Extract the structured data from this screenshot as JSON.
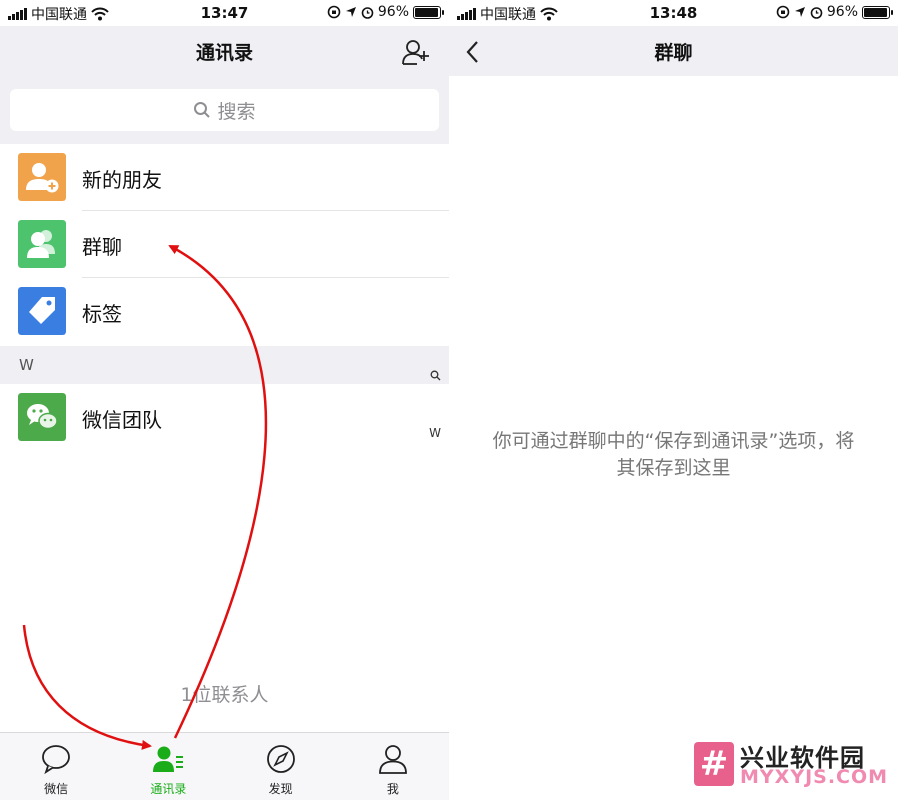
{
  "left_screen": {
    "status_bar": {
      "carrier": "中国联通",
      "time": "13:47",
      "battery": "96%"
    },
    "nav": {
      "title": "通讯录",
      "add_friend_icon": "add-contact-icon"
    },
    "search": {
      "placeholder": "搜索"
    },
    "top_items": [
      {
        "label": "新的朋友",
        "icon": "new-friend-icon",
        "color": "#f0a34a"
      },
      {
        "label": "群聊",
        "icon": "group-chat-icon",
        "color": "#4cc36c"
      },
      {
        "label": "标签",
        "icon": "tag-icon",
        "color": "#3a7ee2"
      }
    ],
    "section": {
      "letter": "W"
    },
    "contacts": [
      {
        "label": "微信团队",
        "icon": "wechat-team-icon",
        "color": "#4caa4a"
      }
    ],
    "index_bar": {
      "search_glyph": "search-icon",
      "letter": "W"
    },
    "contact_count": "1位联系人",
    "tabbar": [
      {
        "label": "微信",
        "icon": "chat-bubble-icon",
        "active": false
      },
      {
        "label": "通讯录",
        "icon": "contacts-icon",
        "active": true
      },
      {
        "label": "发现",
        "icon": "compass-icon",
        "active": false
      },
      {
        "label": "我",
        "icon": "person-icon",
        "active": false
      }
    ]
  },
  "right_screen": {
    "status_bar": {
      "carrier": "中国联通",
      "time": "13:48",
      "battery": "96%"
    },
    "nav": {
      "title": "群聊",
      "back_icon": "back-chevron-icon"
    },
    "empty_message_line1": "你可通过群聊中的“保存到通讯录”选项，将",
    "empty_message_line2": "其保存到这里"
  },
  "watermark": {
    "title": "兴业软件园",
    "subtitle": "MYXYJS.COM",
    "logo_glyph": "#"
  },
  "colors": {
    "accent_green": "#1aad19",
    "annotation_red": "#e01010",
    "nav_bg": "#efeff4"
  }
}
